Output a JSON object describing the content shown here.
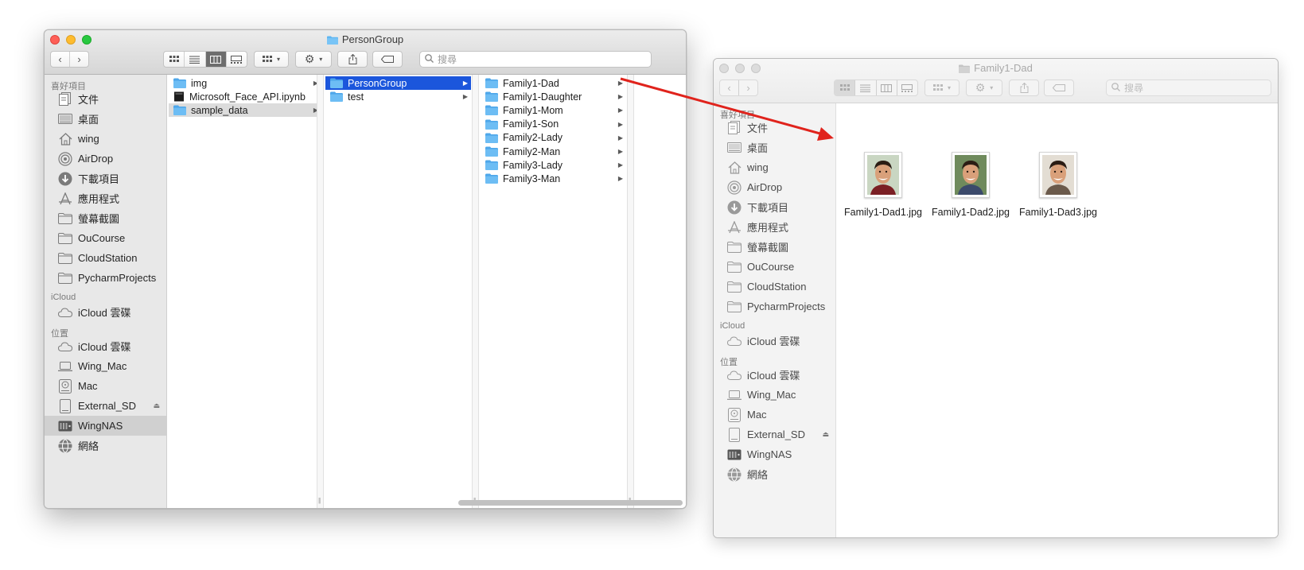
{
  "colors": {
    "accent": "#1b56dc",
    "folder": "#5fb6f1",
    "arrow": "#e0231c"
  },
  "window_a": {
    "title": "PersonGroup",
    "search_placeholder": "搜尋",
    "view_mode": "columns",
    "sidebar": {
      "favorites_header": "喜好項目",
      "favorites": [
        {
          "label": "文件",
          "icon": "document-icon"
        },
        {
          "label": "桌面",
          "icon": "desktop-icon"
        },
        {
          "label": "wing",
          "icon": "home-icon"
        },
        {
          "label": "AirDrop",
          "icon": "airdrop-icon"
        },
        {
          "label": "下載項目",
          "icon": "download-icon"
        },
        {
          "label": "應用程式",
          "icon": "applications-icon"
        },
        {
          "label": "螢幕截圖",
          "icon": "folder-icon"
        },
        {
          "label": "OuCourse",
          "icon": "folder-icon"
        },
        {
          "label": "CloudStation",
          "icon": "folder-icon"
        },
        {
          "label": "PycharmProjects",
          "icon": "folder-icon"
        }
      ],
      "icloud_header": "iCloud",
      "icloud": [
        {
          "label": "iCloud 雲碟",
          "icon": "cloud-icon"
        }
      ],
      "locations_header": "位置",
      "locations": [
        {
          "label": "iCloud 雲碟",
          "icon": "cloud-icon"
        },
        {
          "label": "Wing_Mac",
          "icon": "laptop-icon"
        },
        {
          "label": "Mac",
          "icon": "disk-icon"
        },
        {
          "label": "External_SD",
          "icon": "external-drive-icon",
          "eject": "⏏"
        },
        {
          "label": "WingNAS",
          "icon": "nas-icon",
          "selected": true
        },
        {
          "label": "網絡",
          "icon": "network-icon"
        }
      ]
    },
    "columns": [
      [
        {
          "label": "img",
          "type": "folder",
          "arrow": true
        },
        {
          "label": "Microsoft_Face_API.ipynb",
          "type": "file",
          "arrow": false
        },
        {
          "label": "sample_data",
          "type": "folder",
          "arrow": true,
          "state": "inactive"
        }
      ],
      [
        {
          "label": "PersonGroup",
          "type": "folder",
          "arrow": true,
          "state": "active"
        },
        {
          "label": "test",
          "type": "folder",
          "arrow": true
        }
      ],
      [
        {
          "label": "Family1-Dad",
          "type": "folder",
          "arrow": true
        },
        {
          "label": "Family1-Daughter",
          "type": "folder",
          "arrow": true
        },
        {
          "label": "Family1-Mom",
          "type": "folder",
          "arrow": true
        },
        {
          "label": "Family1-Son",
          "type": "folder",
          "arrow": true
        },
        {
          "label": "Family2-Lady",
          "type": "folder",
          "arrow": true
        },
        {
          "label": "Family2-Man",
          "type": "folder",
          "arrow": true
        },
        {
          "label": "Family3-Lady",
          "type": "folder",
          "arrow": true
        },
        {
          "label": "Family3-Man",
          "type": "folder",
          "arrow": true
        }
      ]
    ]
  },
  "window_b": {
    "title": "Family1-Dad",
    "search_placeholder": "搜尋",
    "view_mode": "icons",
    "sidebar": {
      "favorites_header": "喜好項目",
      "favorites": [
        {
          "label": "文件",
          "icon": "document-icon"
        },
        {
          "label": "桌面",
          "icon": "desktop-icon"
        },
        {
          "label": "wing",
          "icon": "home-icon"
        },
        {
          "label": "AirDrop",
          "icon": "airdrop-icon"
        },
        {
          "label": "下載項目",
          "icon": "download-icon"
        },
        {
          "label": "應用程式",
          "icon": "applications-icon"
        },
        {
          "label": "螢幕截圖",
          "icon": "folder-icon"
        },
        {
          "label": "OuCourse",
          "icon": "folder-icon"
        },
        {
          "label": "CloudStation",
          "icon": "folder-icon"
        },
        {
          "label": "PycharmProjects",
          "icon": "folder-icon"
        }
      ],
      "icloud_header": "iCloud",
      "icloud": [
        {
          "label": "iCloud 雲碟",
          "icon": "cloud-icon"
        }
      ],
      "locations_header": "位置",
      "locations": [
        {
          "label": "iCloud 雲碟",
          "icon": "cloud-icon"
        },
        {
          "label": "Wing_Mac",
          "icon": "laptop-icon"
        },
        {
          "label": "Mac",
          "icon": "disk-icon"
        },
        {
          "label": "External_SD",
          "icon": "external-drive-icon",
          "eject": "⏏"
        },
        {
          "label": "WingNAS",
          "icon": "nas-icon"
        },
        {
          "label": "網絡",
          "icon": "network-icon"
        }
      ]
    },
    "files": [
      {
        "name": "Family1-Dad1.jpg",
        "icon": "photo-thumbnail-icon"
      },
      {
        "name": "Family1-Dad2.jpg",
        "icon": "photo-thumbnail-icon"
      },
      {
        "name": "Family1-Dad3.jpg",
        "icon": "photo-thumbnail-icon"
      }
    ]
  }
}
